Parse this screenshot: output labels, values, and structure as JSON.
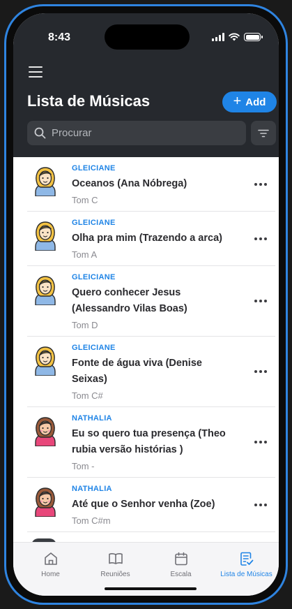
{
  "status_bar": {
    "time": "8:43"
  },
  "header": {
    "title": "Lista de Músicas",
    "add_label": "Add",
    "search_placeholder": "Procurar"
  },
  "songs": [
    {
      "singer": "GLEICIANE",
      "title": "Oceanos (Ana Nóbrega)",
      "tone": "Tom C",
      "avatar": "blonde-woman-avatar"
    },
    {
      "singer": "GLEICIANE",
      "title": "Olha pra mim (Trazendo a arca)",
      "tone": "Tom A",
      "avatar": "blonde-woman-avatar"
    },
    {
      "singer": "GLEICIANE",
      "title": "Quero conhecer Jesus (Alessandro Vilas Boas)",
      "tone": "Tom D",
      "avatar": "blonde-woman-avatar"
    },
    {
      "singer": "GLEICIANE",
      "title": "Fonte de água viva (Denise Seixas)",
      "tone": "Tom C#",
      "avatar": "blonde-woman-avatar"
    },
    {
      "singer": "NATHALIA",
      "title": "Eu so quero tua presença  (Theo rubia versão histórias )",
      "tone": "Tom -",
      "avatar": "brunette-woman-avatar"
    },
    {
      "singer": "NATHALIA",
      "title": "Até que o Senhor venha  (Zoe)",
      "tone": "Tom C#m",
      "avatar": "brunette-woman-avatar"
    }
  ],
  "tabs": [
    {
      "label": "Home",
      "icon": "home-icon"
    },
    {
      "label": "Reuniões",
      "icon": "book-icon"
    },
    {
      "label": "Escala",
      "icon": "calendar-icon"
    },
    {
      "label": "Lista de Músicas",
      "icon": "list-check-icon"
    }
  ],
  "colors": {
    "accent": "#1f84e6",
    "header_bg": "#26292e",
    "input_bg": "#3a3d42",
    "frame": "#2f84e0"
  }
}
